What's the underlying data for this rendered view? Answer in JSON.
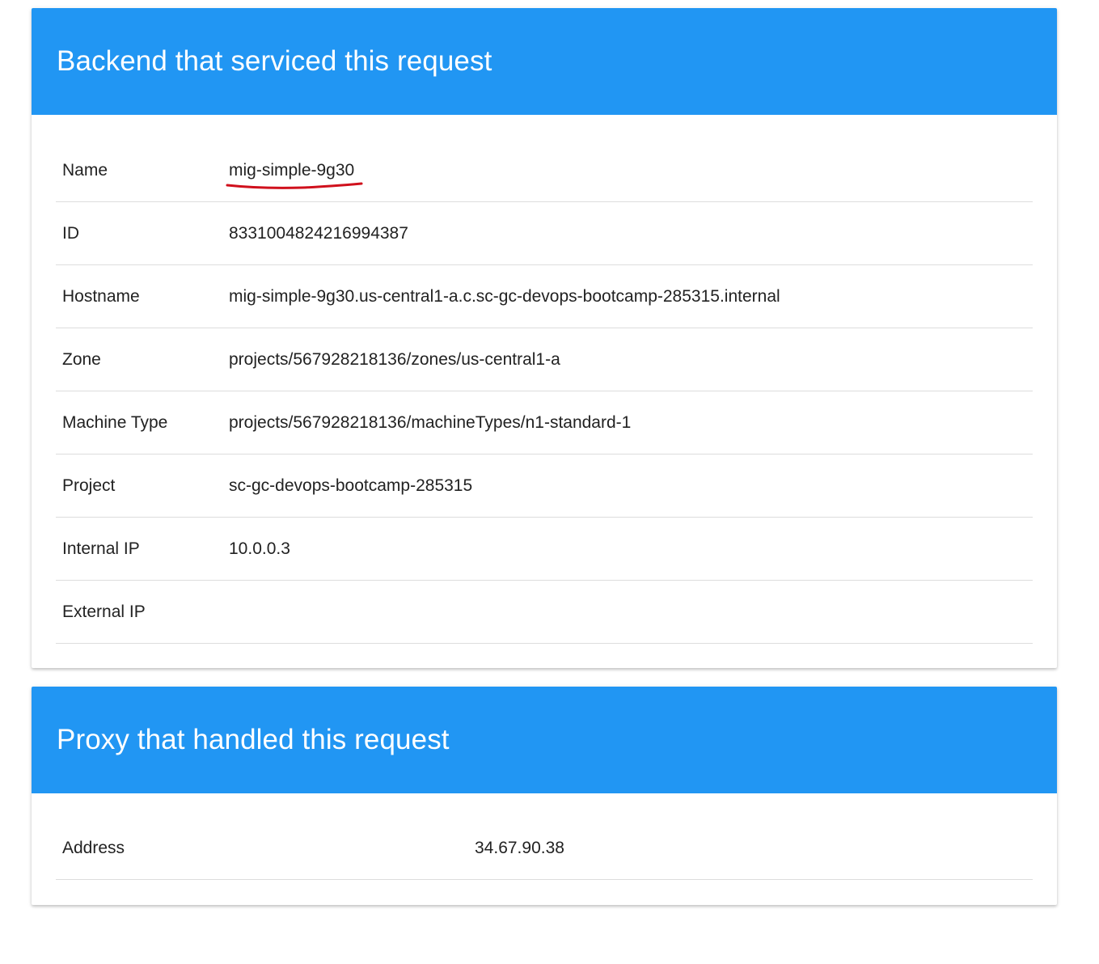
{
  "backend": {
    "title": "Backend that serviced this request",
    "rows": [
      {
        "label": "Name",
        "value": "mig-simple-9g30"
      },
      {
        "label": "ID",
        "value": "8331004824216994387"
      },
      {
        "label": "Hostname",
        "value": "mig-simple-9g30.us-central1-a.c.sc-gc-devops-bootcamp-285315.internal"
      },
      {
        "label": "Zone",
        "value": "projects/567928218136/zones/us-central1-a"
      },
      {
        "label": "Machine Type",
        "value": "projects/567928218136/machineTypes/n1-standard-1"
      },
      {
        "label": "Project",
        "value": "sc-gc-devops-bootcamp-285315"
      },
      {
        "label": "Internal IP",
        "value": "10.0.0.3"
      },
      {
        "label": "External IP",
        "value": ""
      }
    ]
  },
  "proxy": {
    "title": "Proxy that handled this request",
    "rows": [
      {
        "label": "Address",
        "value": "34.67.90.38"
      }
    ]
  },
  "colors": {
    "header": "#2196f3",
    "annotation": "#d0101c"
  }
}
